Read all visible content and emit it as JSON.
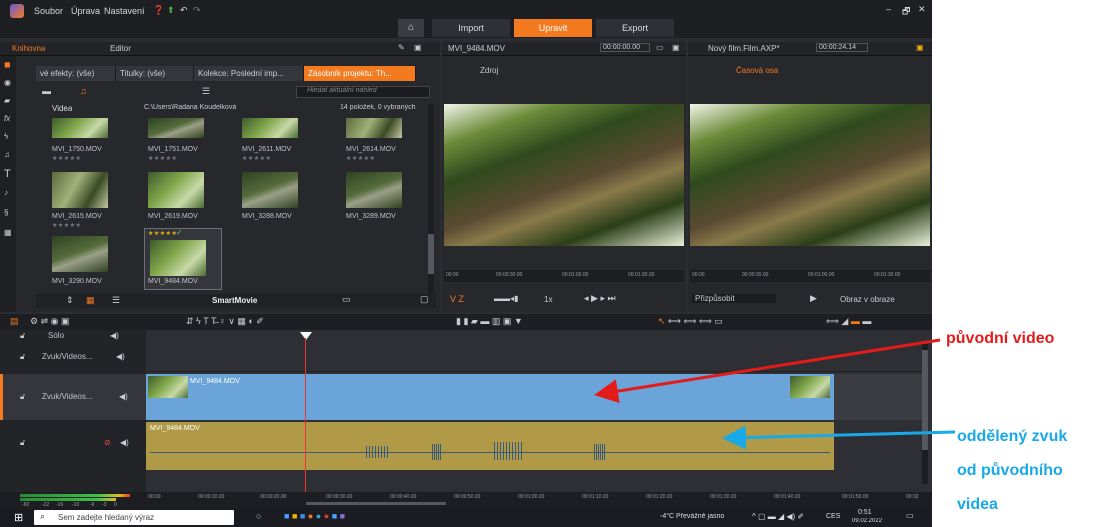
{
  "menu": {
    "items": [
      "Soubor",
      "Úprava",
      "Nastavení"
    ]
  },
  "modes": {
    "import": "Import",
    "edit": "Upravit",
    "export": "Export"
  },
  "left_panel": {
    "library_tab": "Knihovna",
    "editor_tab": "Editor",
    "filters": [
      "vé efekty: (vše)",
      "Titulky: (vše)",
      "Kolekce: Poslední imp...",
      "Zásobník projektu: Th..."
    ],
    "search_placeholder": "Hledat aktuální náhled",
    "tree_label": "Videa",
    "path": "C:\\Users\\Radana Koudelková",
    "count": "14 položek, 0 vybraných",
    "files": [
      {
        "name": "MVI_1750.MOV",
        "stars": "★★★★★"
      },
      {
        "name": "MVI_1751.MOV",
        "stars": "★★★★★"
      },
      {
        "name": "MVI_2611.MOV",
        "stars": "★★★★★"
      },
      {
        "name": "MVI_2614.MOV",
        "stars": "★★★★★"
      },
      {
        "name": "MVI_2615.MOV",
        "stars": "★★★★★"
      },
      {
        "name": "MVI_2619.MOV",
        "stars": ""
      },
      {
        "name": "MVI_3288.MOV",
        "stars": ""
      },
      {
        "name": "MVI_3289.MOV",
        "stars": ""
      },
      {
        "name": "MVI_3290.MOV",
        "stars": ""
      },
      {
        "name": "MVI_9484.MOV",
        "stars": "★★★★★"
      }
    ],
    "smartmovie": "SmartMovie"
  },
  "source_panel": {
    "title": "MVI_9484.MOV",
    "tc": "00:00:00.00",
    "label": "Zdroj",
    "ruler": [
      "00:00",
      "00:00:30.00",
      "00:01:00.00",
      "00:01:30.00"
    ],
    "speed": "1x"
  },
  "timeline_panel": {
    "title": "Nový film.Film.AXP*",
    "tc": "00:00:24.14",
    "label": "Časová osa",
    "ruler": [
      "00:00",
      "00:00:30.00",
      "00:01:00.00",
      "00:01:30.00"
    ],
    "fit": "Přizpůsobit",
    "pip": "Obraz v obraze"
  },
  "tracks": [
    {
      "name": "Sólo"
    },
    {
      "name": "Zvuk/Videos..."
    },
    {
      "name": "Zvuk/Videos..."
    },
    {
      "name": ""
    }
  ],
  "clips": {
    "video": "MVI_9484.MOV",
    "audio": "MVI_9484.MOV"
  },
  "timeline_ruler": [
    "00:00",
    "00:00:10.00",
    "00:00:20.00",
    "00:00:30.00",
    "00:00:40.00",
    "00:00:50.00",
    "00:01:00.00",
    "00:01:10.00",
    "00:01:20.00",
    "00:01:30.00",
    "00:01:40.00",
    "00:01:50.00",
    "00:02"
  ],
  "meter_ticks": [
    "-60",
    "-22",
    "-16",
    "-10",
    "-6",
    "-3",
    "0"
  ],
  "taskbar": {
    "search": "Sem zadejte hledaný výraz",
    "weather": "-4°C  Převážně jasno",
    "lang": "CES",
    "time": "0:51",
    "date": "09.02.2022"
  },
  "annotations": {
    "original": "původní video",
    "separated_1": "oddělený zvuk",
    "separated_2": "od původního",
    "separated_3": "videa"
  },
  "colors": {
    "accent": "#f47a20",
    "video_clip": "#6aa4d8",
    "audio_clip": "#b09a48",
    "arrow_red": "#e41b1b",
    "arrow_blue": "#19a9e6"
  }
}
